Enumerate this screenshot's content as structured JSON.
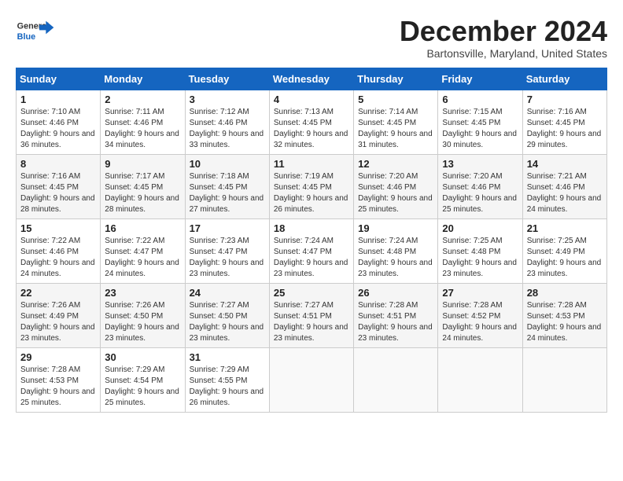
{
  "header": {
    "logo_general": "General",
    "logo_blue": "Blue",
    "month_title": "December 2024",
    "location": "Bartonsville, Maryland, United States"
  },
  "calendar": {
    "days_of_week": [
      "Sunday",
      "Monday",
      "Tuesday",
      "Wednesday",
      "Thursday",
      "Friday",
      "Saturday"
    ],
    "weeks": [
      [
        {
          "day": "1",
          "sunrise": "Sunrise: 7:10 AM",
          "sunset": "Sunset: 4:46 PM",
          "daylight": "Daylight: 9 hours and 36 minutes."
        },
        {
          "day": "2",
          "sunrise": "Sunrise: 7:11 AM",
          "sunset": "Sunset: 4:46 PM",
          "daylight": "Daylight: 9 hours and 34 minutes."
        },
        {
          "day": "3",
          "sunrise": "Sunrise: 7:12 AM",
          "sunset": "Sunset: 4:46 PM",
          "daylight": "Daylight: 9 hours and 33 minutes."
        },
        {
          "day": "4",
          "sunrise": "Sunrise: 7:13 AM",
          "sunset": "Sunset: 4:45 PM",
          "daylight": "Daylight: 9 hours and 32 minutes."
        },
        {
          "day": "5",
          "sunrise": "Sunrise: 7:14 AM",
          "sunset": "Sunset: 4:45 PM",
          "daylight": "Daylight: 9 hours and 31 minutes."
        },
        {
          "day": "6",
          "sunrise": "Sunrise: 7:15 AM",
          "sunset": "Sunset: 4:45 PM",
          "daylight": "Daylight: 9 hours and 30 minutes."
        },
        {
          "day": "7",
          "sunrise": "Sunrise: 7:16 AM",
          "sunset": "Sunset: 4:45 PM",
          "daylight": "Daylight: 9 hours and 29 minutes."
        }
      ],
      [
        {
          "day": "8",
          "sunrise": "Sunrise: 7:16 AM",
          "sunset": "Sunset: 4:45 PM",
          "daylight": "Daylight: 9 hours and 28 minutes."
        },
        {
          "day": "9",
          "sunrise": "Sunrise: 7:17 AM",
          "sunset": "Sunset: 4:45 PM",
          "daylight": "Daylight: 9 hours and 28 minutes."
        },
        {
          "day": "10",
          "sunrise": "Sunrise: 7:18 AM",
          "sunset": "Sunset: 4:45 PM",
          "daylight": "Daylight: 9 hours and 27 minutes."
        },
        {
          "day": "11",
          "sunrise": "Sunrise: 7:19 AM",
          "sunset": "Sunset: 4:45 PM",
          "daylight": "Daylight: 9 hours and 26 minutes."
        },
        {
          "day": "12",
          "sunrise": "Sunrise: 7:20 AM",
          "sunset": "Sunset: 4:46 PM",
          "daylight": "Daylight: 9 hours and 25 minutes."
        },
        {
          "day": "13",
          "sunrise": "Sunrise: 7:20 AM",
          "sunset": "Sunset: 4:46 PM",
          "daylight": "Daylight: 9 hours and 25 minutes."
        },
        {
          "day": "14",
          "sunrise": "Sunrise: 7:21 AM",
          "sunset": "Sunset: 4:46 PM",
          "daylight": "Daylight: 9 hours and 24 minutes."
        }
      ],
      [
        {
          "day": "15",
          "sunrise": "Sunrise: 7:22 AM",
          "sunset": "Sunset: 4:46 PM",
          "daylight": "Daylight: 9 hours and 24 minutes."
        },
        {
          "day": "16",
          "sunrise": "Sunrise: 7:22 AM",
          "sunset": "Sunset: 4:47 PM",
          "daylight": "Daylight: 9 hours and 24 minutes."
        },
        {
          "day": "17",
          "sunrise": "Sunrise: 7:23 AM",
          "sunset": "Sunset: 4:47 PM",
          "daylight": "Daylight: 9 hours and 23 minutes."
        },
        {
          "day": "18",
          "sunrise": "Sunrise: 7:24 AM",
          "sunset": "Sunset: 4:47 PM",
          "daylight": "Daylight: 9 hours and 23 minutes."
        },
        {
          "day": "19",
          "sunrise": "Sunrise: 7:24 AM",
          "sunset": "Sunset: 4:48 PM",
          "daylight": "Daylight: 9 hours and 23 minutes."
        },
        {
          "day": "20",
          "sunrise": "Sunrise: 7:25 AM",
          "sunset": "Sunset: 4:48 PM",
          "daylight": "Daylight: 9 hours and 23 minutes."
        },
        {
          "day": "21",
          "sunrise": "Sunrise: 7:25 AM",
          "sunset": "Sunset: 4:49 PM",
          "daylight": "Daylight: 9 hours and 23 minutes."
        }
      ],
      [
        {
          "day": "22",
          "sunrise": "Sunrise: 7:26 AM",
          "sunset": "Sunset: 4:49 PM",
          "daylight": "Daylight: 9 hours and 23 minutes."
        },
        {
          "day": "23",
          "sunrise": "Sunrise: 7:26 AM",
          "sunset": "Sunset: 4:50 PM",
          "daylight": "Daylight: 9 hours and 23 minutes."
        },
        {
          "day": "24",
          "sunrise": "Sunrise: 7:27 AM",
          "sunset": "Sunset: 4:50 PM",
          "daylight": "Daylight: 9 hours and 23 minutes."
        },
        {
          "day": "25",
          "sunrise": "Sunrise: 7:27 AM",
          "sunset": "Sunset: 4:51 PM",
          "daylight": "Daylight: 9 hours and 23 minutes."
        },
        {
          "day": "26",
          "sunrise": "Sunrise: 7:28 AM",
          "sunset": "Sunset: 4:51 PM",
          "daylight": "Daylight: 9 hours and 23 minutes."
        },
        {
          "day": "27",
          "sunrise": "Sunrise: 7:28 AM",
          "sunset": "Sunset: 4:52 PM",
          "daylight": "Daylight: 9 hours and 24 minutes."
        },
        {
          "day": "28",
          "sunrise": "Sunrise: 7:28 AM",
          "sunset": "Sunset: 4:53 PM",
          "daylight": "Daylight: 9 hours and 24 minutes."
        }
      ],
      [
        {
          "day": "29",
          "sunrise": "Sunrise: 7:28 AM",
          "sunset": "Sunset: 4:53 PM",
          "daylight": "Daylight: 9 hours and 25 minutes."
        },
        {
          "day": "30",
          "sunrise": "Sunrise: 7:29 AM",
          "sunset": "Sunset: 4:54 PM",
          "daylight": "Daylight: 9 hours and 25 minutes."
        },
        {
          "day": "31",
          "sunrise": "Sunrise: 7:29 AM",
          "sunset": "Sunset: 4:55 PM",
          "daylight": "Daylight: 9 hours and 26 minutes."
        },
        {
          "day": "",
          "sunrise": "",
          "sunset": "",
          "daylight": ""
        },
        {
          "day": "",
          "sunrise": "",
          "sunset": "",
          "daylight": ""
        },
        {
          "day": "",
          "sunrise": "",
          "sunset": "",
          "daylight": ""
        },
        {
          "day": "",
          "sunrise": "",
          "sunset": "",
          "daylight": ""
        }
      ]
    ]
  }
}
